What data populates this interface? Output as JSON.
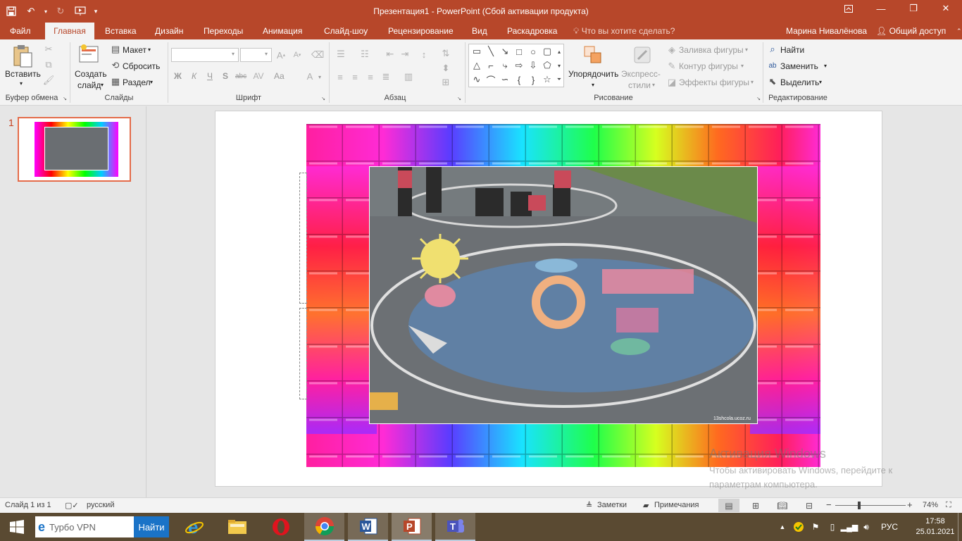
{
  "window": {
    "title": "Презентация1 - PowerPoint (Сбой активации продукта)"
  },
  "tabs": {
    "file": "Файл",
    "home": "Главная",
    "insert": "Вставка",
    "design": "Дизайн",
    "transitions": "Переходы",
    "animations": "Анимация",
    "slideshow": "Слайд-шоу",
    "review": "Рецензирование",
    "view": "Вид",
    "storyboard": "Раскадровка",
    "tell_me": "Что вы хотите сделать?",
    "user": "Марина Нивалёнова",
    "share": "Общий доступ"
  },
  "ribbon": {
    "clipboard": {
      "paste": "Вставить",
      "label": "Буфер обмена"
    },
    "slides": {
      "new_slide_1": "Создать",
      "new_slide_2": "слайд",
      "layout": "Макет",
      "reset": "Сбросить",
      "section": "Раздел",
      "label": "Слайды"
    },
    "font": {
      "label": "Шрифт",
      "bold": "Ж",
      "italic": "К",
      "underline": "Ч",
      "shadow": "S",
      "strike": "abc",
      "case": "Aa"
    },
    "paragraph": {
      "label": "Абзац"
    },
    "drawing": {
      "arrange": "Упорядочить",
      "quick_styles_1": "Экспресс-",
      "quick_styles_2": "стили",
      "fill": "Заливка фигуры",
      "outline": "Контур фигуры",
      "effects": "Эффекты фигуры",
      "label": "Рисование"
    },
    "editing": {
      "find": "Найти",
      "replace": "Заменить",
      "select": "Выделить",
      "label": "Редактирование"
    }
  },
  "thumbnails": {
    "slide_number": "1"
  },
  "slide": {
    "photo_watermark": "13shcola.ucoz.ru"
  },
  "activation": {
    "title": "Активация Windows",
    "text": "Чтобы активировать Windows, перейдите к параметрам компьютера."
  },
  "status": {
    "slide_of": "Слайд 1 из 1",
    "language": "русский",
    "notes": "Заметки",
    "comments": "Примечания",
    "zoom": "74%"
  },
  "taskbar": {
    "search_placeholder": "Турбо VPN",
    "find": "Найти",
    "lang": "РУС",
    "time": "17:58",
    "date": "25.01.2021"
  },
  "colors": {
    "accent": "#b7472a",
    "ribbon_bg": "#f3f3f3",
    "selection": "#e46c4a"
  }
}
